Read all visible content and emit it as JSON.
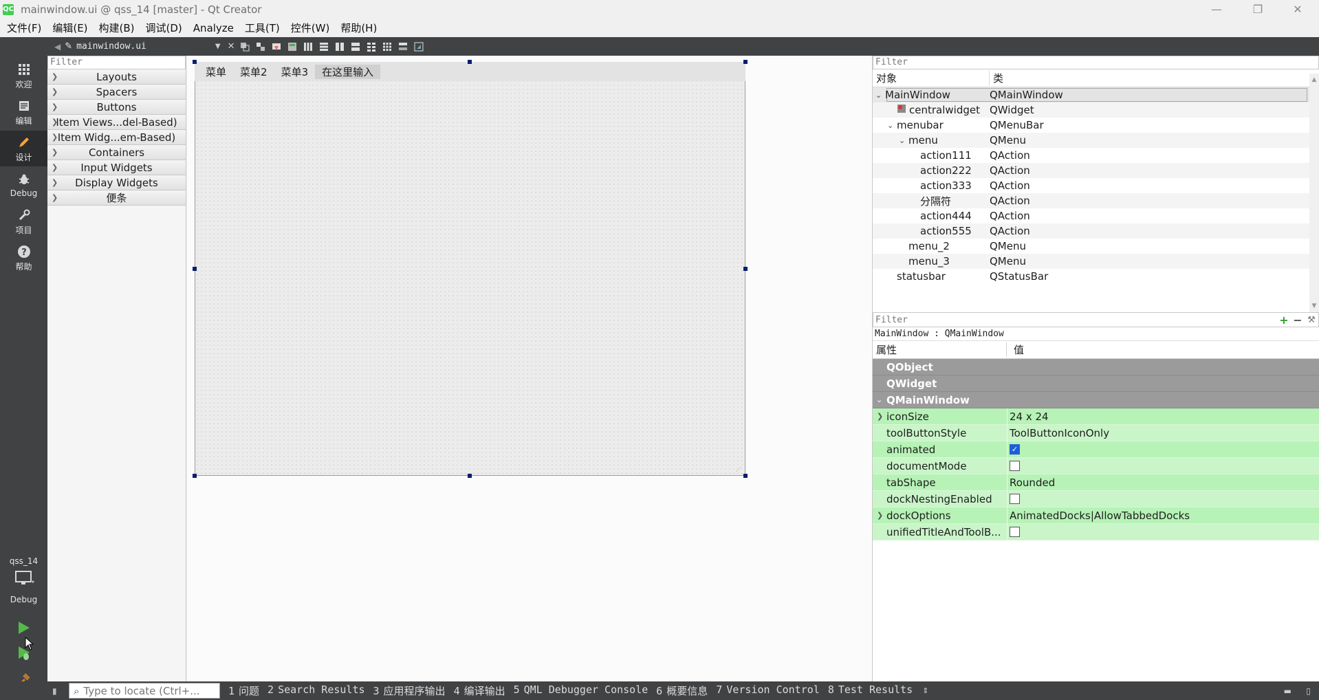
{
  "window": {
    "title": "mainwindow.ui @ qss_14 [master] - Qt Creator",
    "app_icon_label": "QC",
    "controls": {
      "minimize": "—",
      "restore": "❐",
      "close": "✕"
    }
  },
  "menubar": {
    "items": [
      "文件(F)",
      "编辑(E)",
      "构建(B)",
      "调试(D)",
      "Analyze",
      "工具(T)",
      "控件(W)",
      "帮助(H)"
    ]
  },
  "modes": {
    "items": [
      {
        "label": "欢迎",
        "icon": "grid-icon"
      },
      {
        "label": "编辑",
        "icon": "doc-icon"
      },
      {
        "label": "设计",
        "icon": "pencil-icon"
      },
      {
        "label": "Debug",
        "icon": "bug-icon"
      },
      {
        "label": "项目",
        "icon": "wrench-icon"
      },
      {
        "label": "帮助",
        "icon": "help-icon"
      }
    ],
    "active": "设计",
    "kit": {
      "project": "qss_14",
      "config": "Debug"
    }
  },
  "editor_toolbar": {
    "doc_name": "mainwindow.ui",
    "close_glyph": "✕"
  },
  "widget_box": {
    "filter_placeholder": "Filter",
    "categories": [
      "Layouts",
      "Spacers",
      "Buttons",
      "Item Views...del-Based)",
      "Item Widg...em-Based)",
      "Containers",
      "Input Widgets",
      "Display Widgets",
      "便条"
    ]
  },
  "form": {
    "menus": [
      "菜单",
      "菜单2",
      "菜单3",
      "在这里输入"
    ]
  },
  "object_inspector": {
    "filter_placeholder": "Filter",
    "col_object": "对象",
    "col_class": "类",
    "rows": [
      {
        "name": "MainWindow",
        "cls": "QMainWindow",
        "depth": 0,
        "expanded": true,
        "selected": true
      },
      {
        "name": "centralwidget",
        "cls": "QWidget",
        "depth": 1,
        "icon": true
      },
      {
        "name": "menubar",
        "cls": "QMenuBar",
        "depth": 1,
        "expanded": true
      },
      {
        "name": "menu",
        "cls": "QMenu",
        "depth": 2,
        "expanded": true
      },
      {
        "name": "action111",
        "cls": "QAction",
        "depth": 3
      },
      {
        "name": "action222",
        "cls": "QAction",
        "depth": 3
      },
      {
        "name": "action333",
        "cls": "QAction",
        "depth": 3
      },
      {
        "name": "分隔符",
        "cls": "QAction",
        "depth": 3
      },
      {
        "name": "action444",
        "cls": "QAction",
        "depth": 3
      },
      {
        "name": "action555",
        "cls": "QAction",
        "depth": 3
      },
      {
        "name": "menu_2",
        "cls": "QMenu",
        "depth": 2
      },
      {
        "name": "menu_3",
        "cls": "QMenu",
        "depth": 2
      },
      {
        "name": "statusbar",
        "cls": "QStatusBar",
        "depth": 1
      }
    ]
  },
  "property_editor": {
    "filter_placeholder": "Filter",
    "object_label": "MainWindow : QMainWindow",
    "col_property": "属性",
    "col_value": "值",
    "groups": [
      "QObject",
      "QWidget",
      "QMainWindow"
    ],
    "properties": [
      {
        "name": "iconSize",
        "value": "24 x 24",
        "expandable": true
      },
      {
        "name": "toolButtonStyle",
        "value": "ToolButtonIconOnly"
      },
      {
        "name": "animated",
        "checkbox": true,
        "checked": true
      },
      {
        "name": "documentMode",
        "checkbox": true,
        "checked": false
      },
      {
        "name": "tabShape",
        "value": "Rounded"
      },
      {
        "name": "dockNestingEnabled",
        "checkbox": true,
        "checked": false
      },
      {
        "name": "dockOptions",
        "value": "AnimatedDocks|AllowTabbedDocks",
        "expandable": true
      },
      {
        "name": "unifiedTitleAndToolB...",
        "checkbox": true,
        "checked": false
      }
    ]
  },
  "statusbar": {
    "locate_placeholder": "Type to locate (Ctrl+...",
    "panes": [
      {
        "num": "1",
        "label": "问题"
      },
      {
        "num": "2",
        "label": "Search Results"
      },
      {
        "num": "3",
        "label": "应用程序输出"
      },
      {
        "num": "4",
        "label": "编译输出"
      },
      {
        "num": "5",
        "label": "QML Debugger Console"
      },
      {
        "num": "6",
        "label": "概要信息"
      },
      {
        "num": "7",
        "label": "Version Control"
      },
      {
        "num": "8",
        "label": "Test Results"
      }
    ]
  },
  "colors": {
    "sidebar": "#404244",
    "property_green": "#b7f2b7",
    "group_gray": "#9b9b9b",
    "selection_handle": "#0a1e6e",
    "active_mode": "#f6a23a",
    "run_green": "#54b948"
  }
}
